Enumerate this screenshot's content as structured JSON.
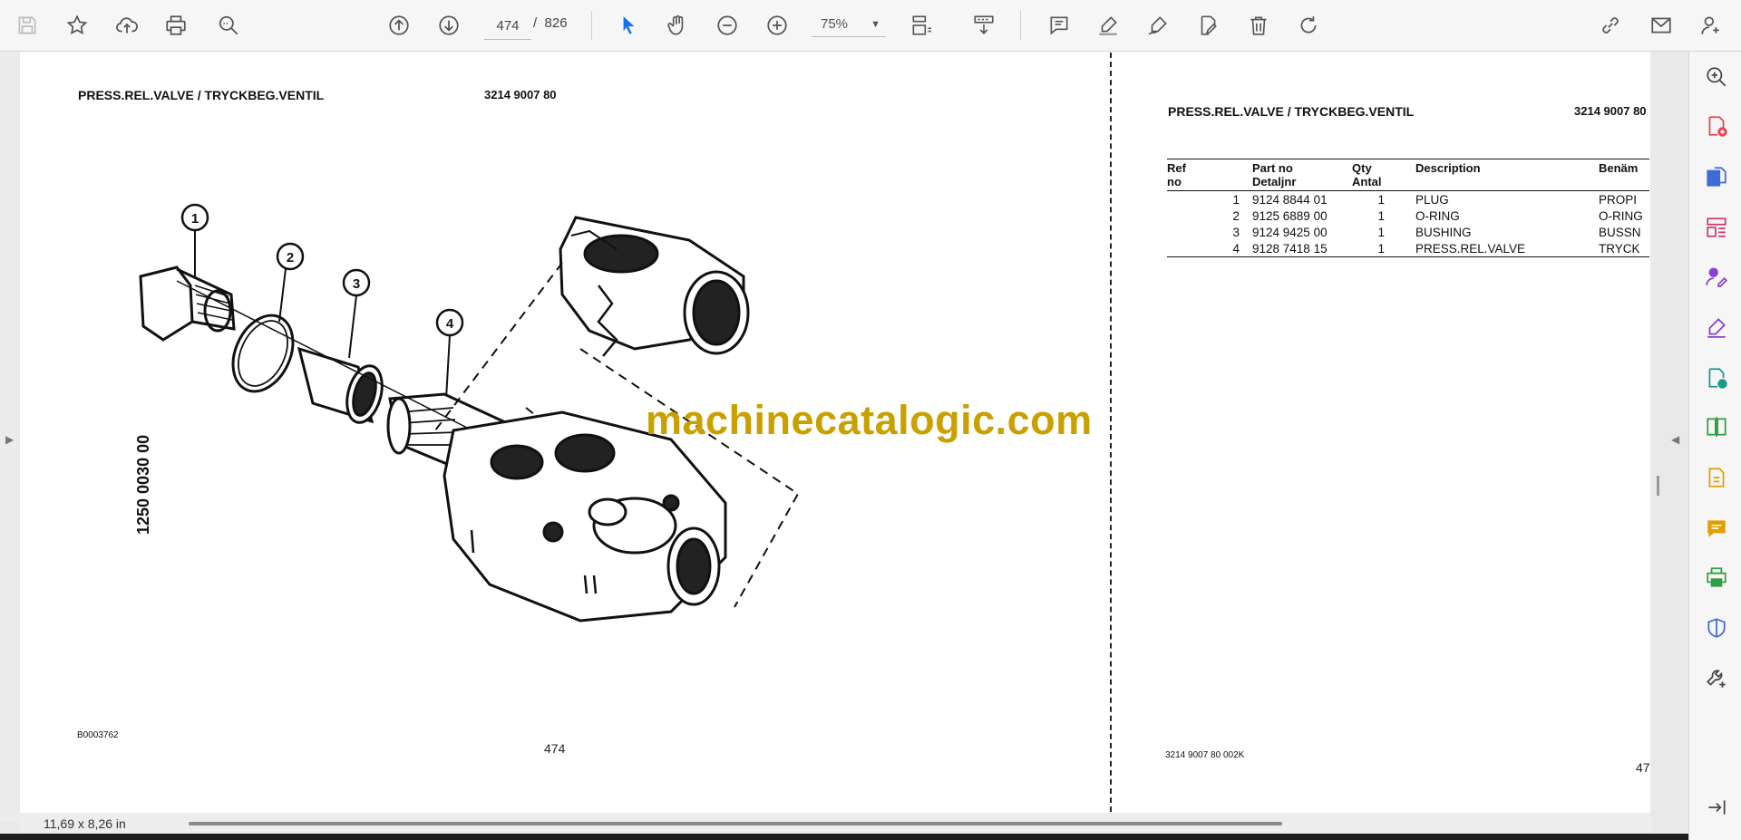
{
  "toolbar": {
    "page_current": "474",
    "page_total": "826",
    "page_sep": "/",
    "zoom": "75%"
  },
  "left_page": {
    "title": "PRESS.REL.VALVE / TRYCKBEG.VENTIL",
    "part_number": "3214 9007 80",
    "vertical_code": "1250 0030 00",
    "image_ref": "B0003762",
    "page_number": "474",
    "callouts": [
      "1",
      "2",
      "3",
      "4"
    ]
  },
  "right_page": {
    "title": "PRESS.REL.VALVE / TRYCKBEG.VENTIL",
    "part_number": "3214 9007 80",
    "footer_code": "3214 9007 80  002K",
    "page_number": "47",
    "headers": {
      "ref_1": "Ref",
      "ref_2": "no",
      "part_1": "Part no",
      "part_2": "Detaljnr",
      "qty_1": "Qty",
      "qty_2": "Antal",
      "desc": "Description",
      "ben": "Benäm"
    },
    "rows": [
      {
        "ref": "1",
        "part": "9124 8844 01",
        "qty": "1",
        "desc": "PLUG",
        "ben": "PROPI"
      },
      {
        "ref": "2",
        "part": "9125 6889 00",
        "qty": "1",
        "desc": "O-RING",
        "ben": "O-RING"
      },
      {
        "ref": "3",
        "part": "9124 9425 00",
        "qty": "1",
        "desc": "BUSHING",
        "ben": "BUSSN"
      },
      {
        "ref": "4",
        "part": "9128 7418 15",
        "qty": "1",
        "desc": "PRESS.REL.VALVE",
        "ben": "TRYCK"
      }
    ]
  },
  "watermark": "machinecatalogic.com",
  "status": {
    "dimensions": "11,69 x 8,26 in"
  }
}
